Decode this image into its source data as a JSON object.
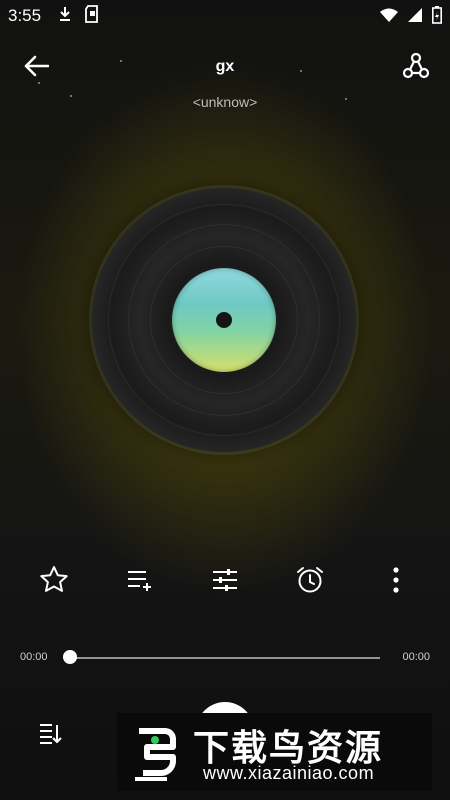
{
  "status_bar": {
    "time": "3:55",
    "icons": [
      "download-icon",
      "sd-card-icon",
      "wifi-icon",
      "signal-icon",
      "battery-icon"
    ]
  },
  "header": {
    "back_icon": "arrow-left-icon",
    "title": "gx",
    "artist": "<unknow>",
    "share_icon": "share-icon"
  },
  "actions": [
    "star-icon",
    "add-to-playlist-icon",
    "equalizer-icon",
    "alarm-icon",
    "more-vert-icon"
  ],
  "progress": {
    "current": "00:00",
    "total": "00:00",
    "fraction": 0.0
  },
  "bottom": {
    "playlist_icon": "playlist-sort-icon"
  },
  "watermark": {
    "title": "下载鸟资源",
    "url": "www.xiazainiao.com"
  },
  "colors": {
    "accent": "#ffffff",
    "glow": "#7d7012"
  }
}
